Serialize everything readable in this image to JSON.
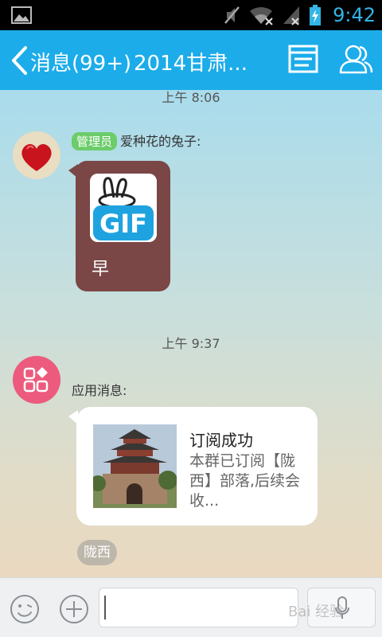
{
  "status_bar": {
    "time": "9:42",
    "icons": [
      "gallery-icon",
      "mute-icon",
      "wifi-icon",
      "signal-icon",
      "battery-icon"
    ]
  },
  "title_bar": {
    "back_label": "消息(99+)",
    "title": "2014甘肃...",
    "icons": [
      "notice-icon",
      "members-icon"
    ]
  },
  "messages": [
    {
      "timestamp": "上午 8:06"
    },
    {
      "sender": {
        "badge": "管理员",
        "name": "爱种花的兔子:"
      },
      "sticker": {
        "label": "GIF"
      },
      "text": "早"
    },
    {
      "timestamp": "上午 9:37"
    },
    {
      "sender": {
        "name": "应用消息:"
      },
      "card": {
        "title": "订阅成功",
        "description": "本群已订阅【陇西】部落,后续会收..."
      },
      "tag": "陇西"
    }
  ],
  "input_bar": {
    "value": "",
    "placeholder": "",
    "watermark": "Bai 经验"
  },
  "colors": {
    "title_bar": "#1cacea",
    "status_accent": "#33b5e5",
    "admin_badge": "#6ccc6a",
    "app_avatar": "#ec5b7e",
    "dark_bubble": "#7a4646"
  }
}
